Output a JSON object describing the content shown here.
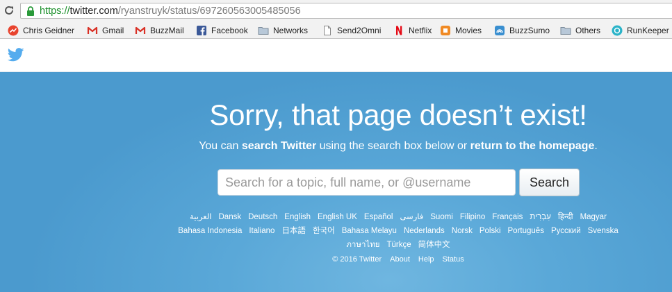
{
  "browser": {
    "url_scheme": "https://",
    "url_host": "twitter.com",
    "url_path": "/ryanstruyk/status/697260563005485056",
    "bookmarks": [
      {
        "label": "Chris Geidner",
        "icon": "chris-geidner-icon",
        "color": "#e8432e"
      },
      {
        "label": "Gmail",
        "icon": "gmail-icon",
        "color": "#d93025"
      },
      {
        "label": "BuzzMail",
        "icon": "gmail-icon",
        "color": "#d93025"
      },
      {
        "label": "Facebook",
        "icon": "facebook-icon",
        "color": "#3b5998"
      },
      {
        "label": "Networks",
        "icon": "folder-icon",
        "color": "#7a8a99"
      },
      {
        "label": "Send2Omni",
        "icon": "page-icon",
        "color": "#888888"
      },
      {
        "label": "Netflix",
        "icon": "netflix-icon",
        "color": "#e50914"
      },
      {
        "label": "Movies",
        "icon": "movies-icon",
        "color": "#f08a24"
      },
      {
        "label": "BuzzSumo",
        "icon": "buzzsumo-icon",
        "color": "#3a8fd0"
      },
      {
        "label": "Others",
        "icon": "folder-icon",
        "color": "#7a8a99"
      },
      {
        "label": "RunKeeper",
        "icon": "runkeeper-icon",
        "color": "#2ab3c8"
      }
    ]
  },
  "page": {
    "headline": "Sorry, that page doesn’t exist!",
    "sub_prefix": "You can ",
    "sub_link1": "search Twitter",
    "sub_middle": " using the search box below or ",
    "sub_link2": "return to the homepage",
    "sub_suffix": ".",
    "search_placeholder": "Search for a topic, full name, or @username",
    "search_button": "Search",
    "brand_color": "#55acee"
  },
  "languages": [
    [
      "العربية",
      "Dansk",
      "Deutsch",
      "English",
      "English UK",
      "Español",
      "فارسی",
      "Suomi",
      "Filipino",
      "Français",
      "עִבְרִית",
      "हिन्दी",
      "Magyar"
    ],
    [
      "Bahasa Indonesia",
      "Italiano",
      "日本語",
      "한국어",
      "Bahasa Melayu",
      "Nederlands",
      "Norsk",
      "Polski",
      "Português",
      "Русский",
      "Svenska"
    ],
    [
      "ภาษาไทย",
      "Türkçe",
      "简体中文"
    ]
  ],
  "footer": [
    "© 2016 Twitter",
    "About",
    "Help",
    "Status"
  ]
}
